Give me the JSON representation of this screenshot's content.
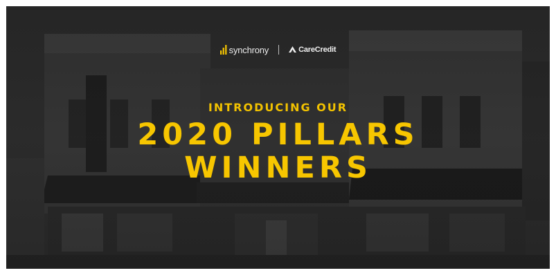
{
  "brand": {
    "synchrony": "synchrony",
    "carecredit": "CareCredit",
    "accent_color": "#f7c600"
  },
  "hero": {
    "intro": "INTRODUCING OUR",
    "headline_line1": "2020 PILLARS",
    "headline_line2": "WINNERS"
  }
}
